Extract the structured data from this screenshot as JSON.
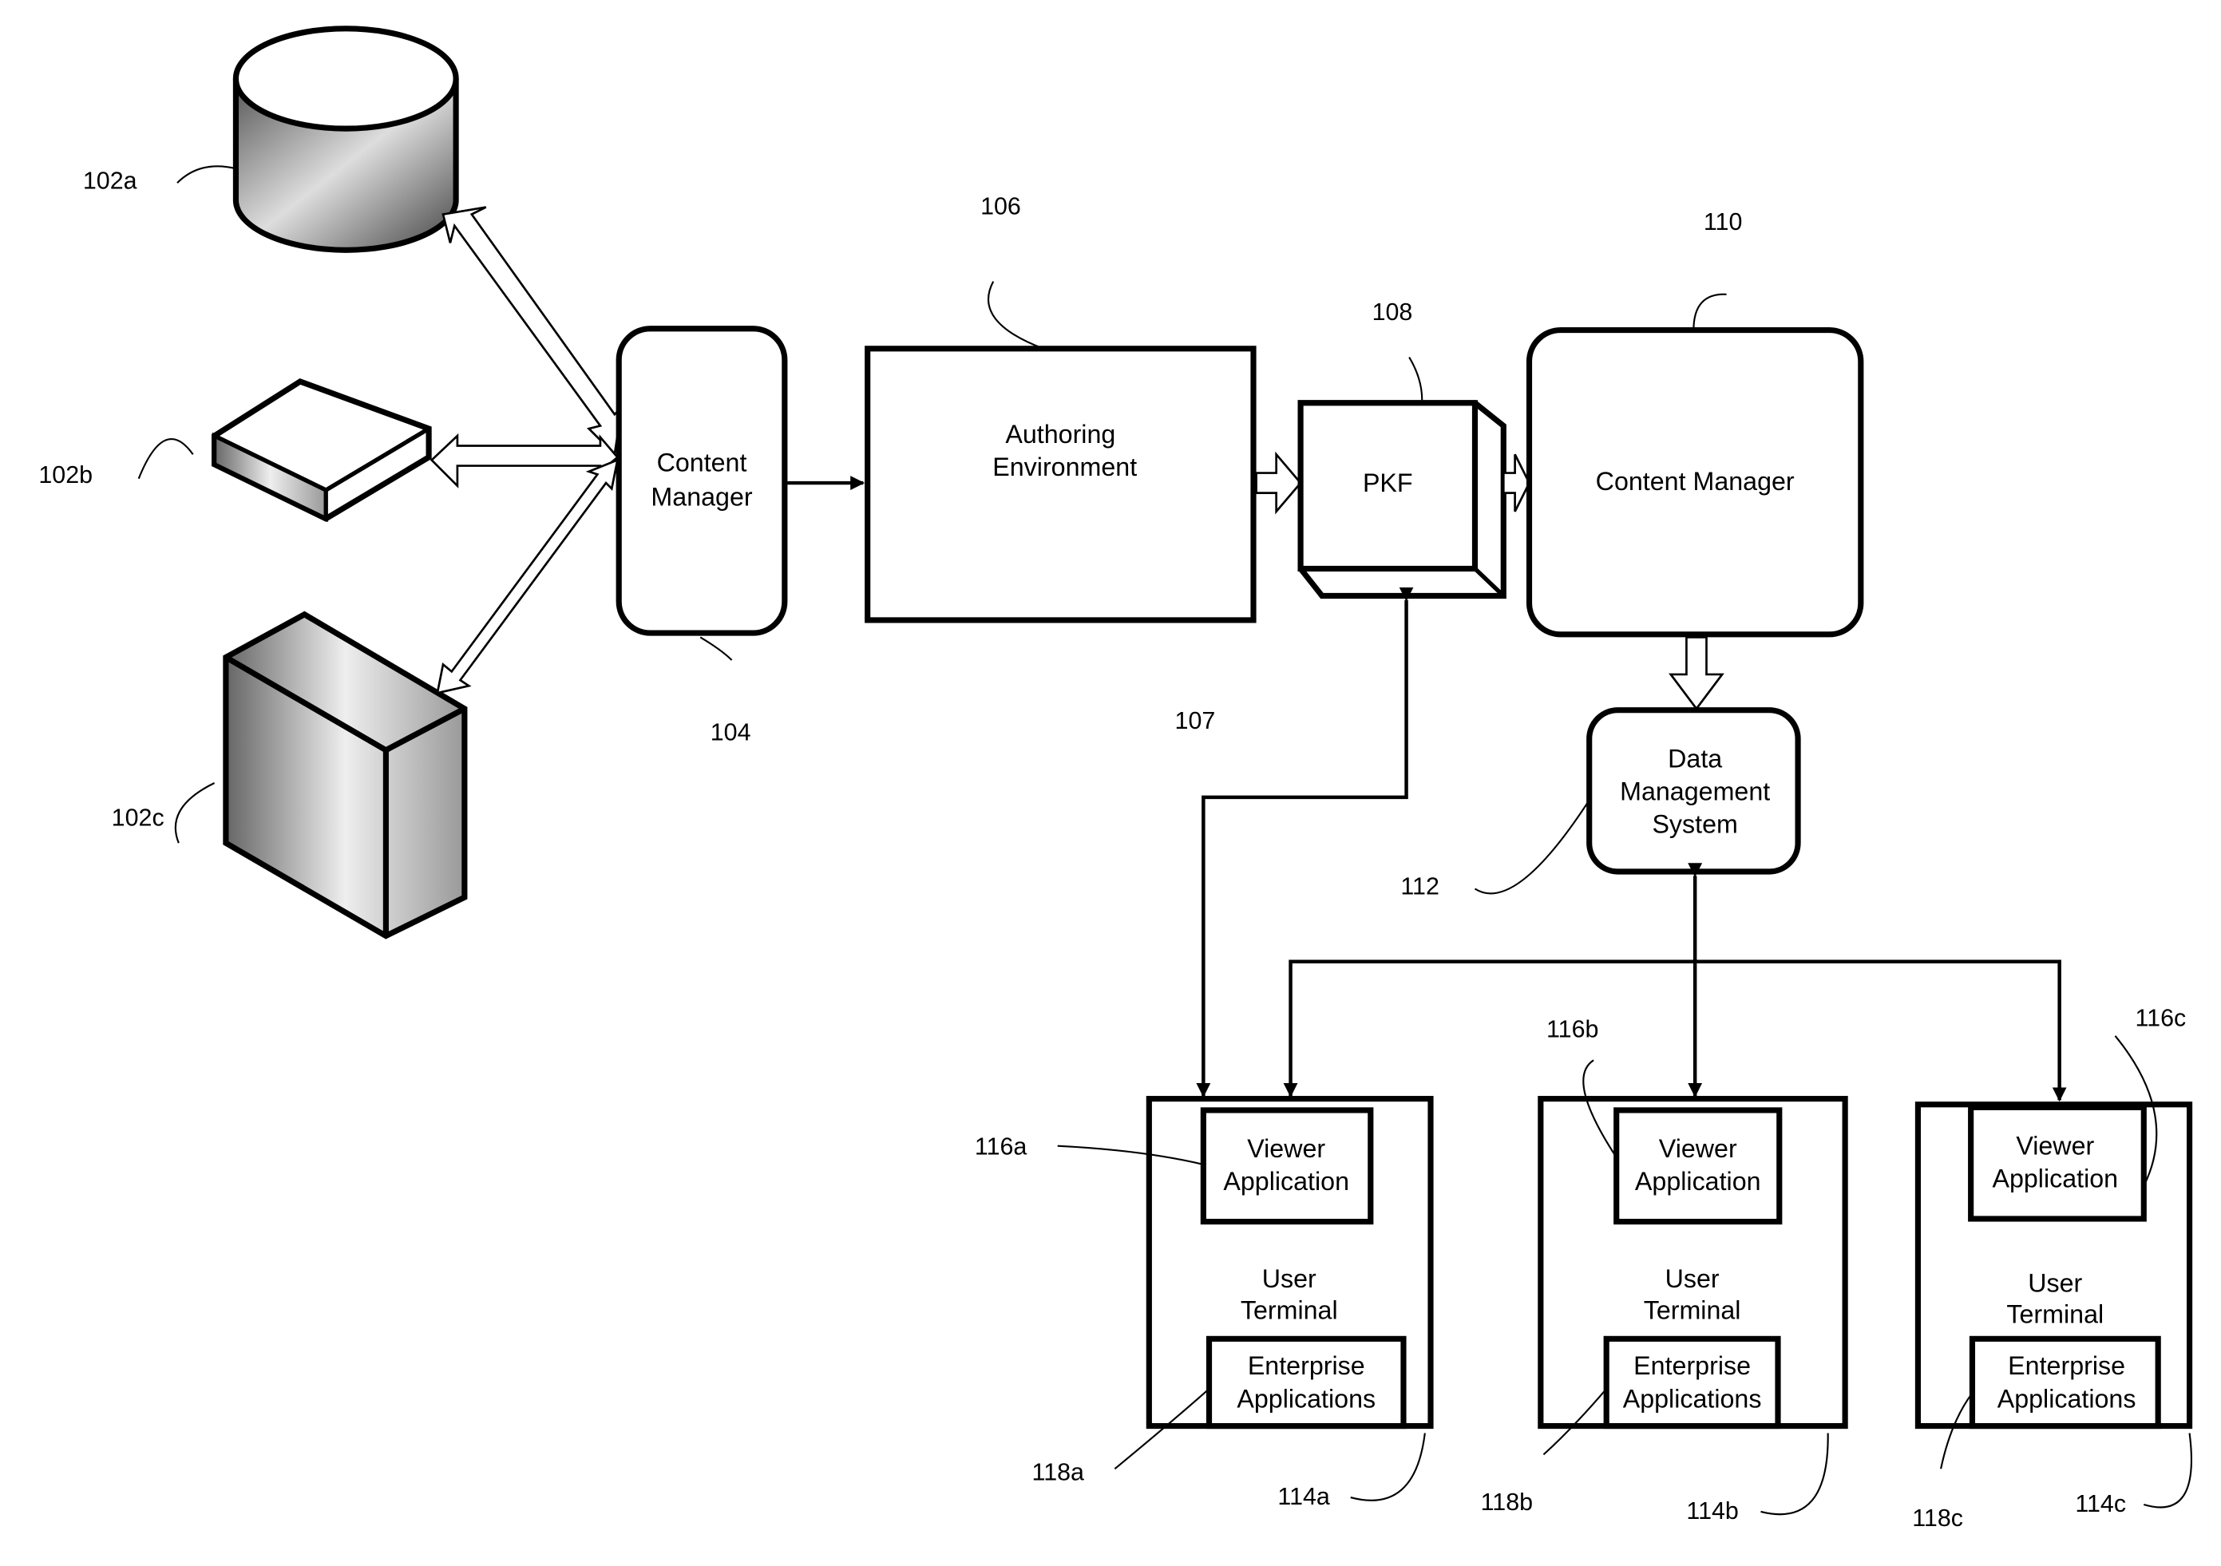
{
  "diagram": {
    "sources": [
      {
        "ref": "102a",
        "kind": "database-cylinder"
      },
      {
        "ref": "102b",
        "kind": "flat-device"
      },
      {
        "ref": "102c",
        "kind": "server-box"
      }
    ],
    "content_manager_left": {
      "ref": "104",
      "lines": [
        "Content",
        "Manager"
      ]
    },
    "authoring": {
      "ref": "106",
      "lines": [
        "Authoring",
        "Environment"
      ]
    },
    "pkf": {
      "ref": "108",
      "label": "PKF"
    },
    "content_manager_right": {
      "ref": "110",
      "label": "Content Manager"
    },
    "link_107": {
      "ref": "107"
    },
    "dms": {
      "ref": "112",
      "lines": [
        "Data",
        "Management",
        "System"
      ]
    },
    "terminals": [
      {
        "ref": "114a",
        "title": [
          "User",
          "Terminal"
        ],
        "viewer_ref": "116a",
        "viewer": [
          "Viewer",
          "Application"
        ],
        "enterprise_ref": "118a",
        "enterprise": [
          "Enterprise",
          "Applications"
        ]
      },
      {
        "ref": "114b",
        "title": [
          "User",
          "Terminal"
        ],
        "viewer_ref": "116b",
        "viewer": [
          "Viewer",
          "Application"
        ],
        "enterprise_ref": "118b",
        "enterprise": [
          "Enterprise",
          "Applications"
        ]
      },
      {
        "ref": "114c",
        "title": [
          "User",
          "Terminal"
        ],
        "viewer_ref": "116c",
        "viewer": [
          "Viewer",
          "Application"
        ],
        "enterprise_ref": "118c",
        "enterprise": [
          "Enterprise",
          "Applications"
        ]
      }
    ]
  }
}
